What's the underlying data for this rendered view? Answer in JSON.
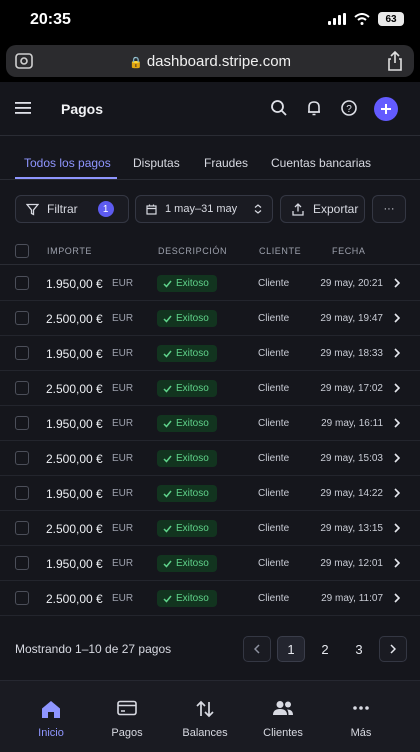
{
  "status_bar": {
    "time": "20:35",
    "battery": "63"
  },
  "browser": {
    "url": "dashboard.stripe.com"
  },
  "header": {
    "title": "Pagos"
  },
  "tabs": [
    {
      "label": "Todos los pagos",
      "active": true
    },
    {
      "label": "Disputas"
    },
    {
      "label": "Fraudes"
    },
    {
      "label": "Cuentas bancarias"
    }
  ],
  "filters": {
    "filter_label": "Filtrar",
    "filter_count": "1",
    "date_range": "1 may–31 may",
    "export_label": "Exportar",
    "more_label": "···"
  },
  "table": {
    "columns": {
      "amount": "IMPORTE",
      "description": "DESCRIPCIÓN",
      "client": "CLIENTE",
      "date": "FECHA"
    },
    "status_color": "#5fd38a",
    "rows": [
      {
        "amount": "1.950,00 €",
        "currency": "EUR",
        "status": "Exitoso",
        "client": "Cliente",
        "date": "29 may, 20:21"
      },
      {
        "amount": "2.500,00 €",
        "currency": "EUR",
        "status": "Exitoso",
        "client": "Cliente",
        "date": "29 may, 19:47"
      },
      {
        "amount": "1.950,00 €",
        "currency": "EUR",
        "status": "Exitoso",
        "client": "Cliente",
        "date": "29 may, 18:33"
      },
      {
        "amount": "2.500,00 €",
        "currency": "EUR",
        "status": "Exitoso",
        "client": "Cliente",
        "date": "29 may, 17:02"
      },
      {
        "amount": "1.950,00 €",
        "currency": "EUR",
        "status": "Exitoso",
        "client": "Cliente",
        "date": "29 may, 16:11"
      },
      {
        "amount": "2.500,00 €",
        "currency": "EUR",
        "status": "Exitoso",
        "client": "Cliente",
        "date": "29 may, 15:03"
      },
      {
        "amount": "1.950,00 €",
        "currency": "EUR",
        "status": "Exitoso",
        "client": "Cliente",
        "date": "29 may, 14:22"
      },
      {
        "amount": "2.500,00 €",
        "currency": "EUR",
        "status": "Exitoso",
        "client": "Cliente",
        "date": "29 may, 13:15"
      },
      {
        "amount": "1.950,00 €",
        "currency": "EUR",
        "status": "Exitoso",
        "client": "Cliente",
        "date": "29 may, 12:01"
      },
      {
        "amount": "2.500,00 €",
        "currency": "EUR",
        "status": "Exitoso",
        "client": "Cliente",
        "date": "29 may, 11:07"
      }
    ]
  },
  "pagination": {
    "summary": "Mostrando 1–10 de 27 pagos",
    "pages": [
      "1",
      "2",
      "3"
    ],
    "current": "1"
  },
  "bottom_nav": [
    {
      "label": "Inicio",
      "icon": "home-icon",
      "active": true
    },
    {
      "label": "Pagos",
      "icon": "card-icon"
    },
    {
      "label": "Balances",
      "icon": "transfer-icon"
    },
    {
      "label": "Clientes",
      "icon": "users-icon"
    },
    {
      "label": "Más",
      "icon": "more-icon"
    }
  ],
  "accent_color": "#635bff"
}
